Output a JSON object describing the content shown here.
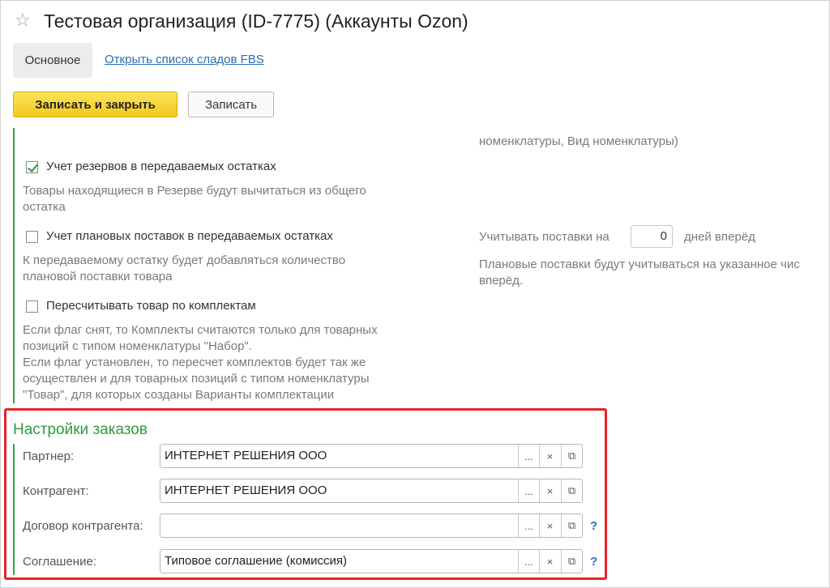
{
  "window": {
    "title": "Тестовая организация (ID-7775) (Аккаунты Ozon)",
    "star_icon": "star-icon"
  },
  "tabs": {
    "main": "Основное",
    "fbs_link": "Открыть список сладов FBS"
  },
  "toolbar": {
    "save_close": "Записать и закрыть",
    "save": "Записать"
  },
  "right_top_text": "номенклатуры, Вид номенклатуры)",
  "settings": {
    "reserves": {
      "label": "Учет резервов в передаваемых остатках",
      "checked": true,
      "hint": "Товары находящиеся в Резерве будут вычитаться из общего\nостатка"
    },
    "planned": {
      "label": "Учет плановых поставок в передаваемых остатках",
      "checked": false,
      "hint": "К передаваемому остатку будет добавляться количество\nплановой поставки товара"
    },
    "kits": {
      "label": "Пересчитывать товар по комплектам",
      "checked": false,
      "hint": "Если флаг снят, то Комплекты считаются только для товарных\nпозиций с типом номенклатуры \"Набор\".\nЕсли флаг установлен, то пересчет комплектов будет так же\nосуществлен и для товарных позиций с типом номенклатуры\n\"Товар\", для которых созданы Варианты комплектации"
    },
    "supplies": {
      "prefix": "Учитывать поставки на",
      "days": "0",
      "suffix": "дней вперёд",
      "hint": "Плановые поставки будут учитываться на указанное чис\nвперёд."
    }
  },
  "orders": {
    "title": "Настройки заказов",
    "buttons": {
      "dots": "...",
      "clear": "×",
      "open": "⧉",
      "help": "?"
    },
    "fields": [
      {
        "label": "Партнер:",
        "value": "ИНТЕРНЕТ РЕШЕНИЯ ООО"
      },
      {
        "label": "Контрагент:",
        "value": "ИНТЕРНЕТ РЕШЕНИЯ ООО"
      },
      {
        "label": "Договор контрагента:",
        "value": ""
      },
      {
        "label": "Соглашение:",
        "value": "Типовое соглашение (комиссия)"
      }
    ]
  }
}
